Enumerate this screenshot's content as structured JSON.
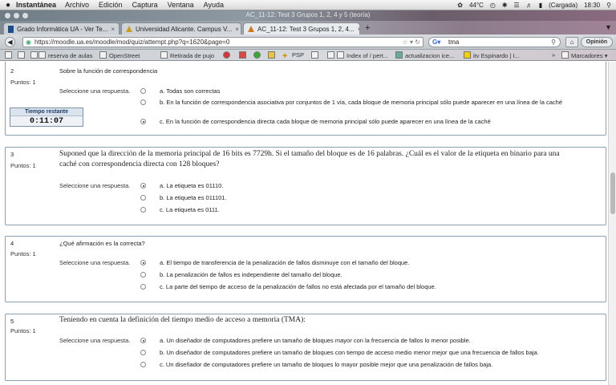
{
  "menubar": {
    "apple": "",
    "app": "Instantánea",
    "items": [
      "Archivo",
      "Edición",
      "Captura",
      "Ventana",
      "Ayuda"
    ],
    "temperature": "44°C",
    "battery": "(Cargada)",
    "clock": "18:30"
  },
  "window": {
    "title": "AC_11-12: Test 3 Grupos 1, 2, 4 y 5 (teoría)"
  },
  "tabs": [
    {
      "label": "Grado Informática UA - Ver Te..."
    },
    {
      "label": "Universidad Alicante. Campus V..."
    },
    {
      "label": "AC_11-12: Test 3 Grupos 1, 2, 4..."
    }
  ],
  "newtab_label": "+",
  "navbar": {
    "url": "https://moodle.ua.es/moodle/mod/quiz/attempt.php?q=1620&page=0",
    "search_value": "tma",
    "options_label": "Opinión"
  },
  "bookmarks": {
    "items": [
      "reserva de aulas",
      "OpenStreet",
      "Retirada de pujo",
      "PSP",
      "Index of / pert...",
      "actualizacion ice...",
      "itv Espinardo | I..."
    ],
    "overflow": "»",
    "folder": "Marcadores"
  },
  "timer": {
    "label": "Tiempo restante",
    "value": "0:11:07"
  },
  "common": {
    "points": "Puntos: 1",
    "select_prompt": "Seleccione una respuesta."
  },
  "questions": [
    {
      "number": "2",
      "text": "Sobre la función de correspondencia",
      "options": [
        {
          "text": "a. Todas son correctas",
          "selected": false
        },
        {
          "text": "b. En la función de correspondencia asociativa por conjuntos de 1 vía, cada bloque de memoria principal sólo puede aparecer en una línea de la caché",
          "selected": false
        },
        {
          "text": "c. En la función de correspondencia directa cada bloque de memoria principal sólo puede aparecer en una línea de la caché",
          "selected": true
        }
      ]
    },
    {
      "number": "3",
      "text": "Suponed que la dirección de la memoria principal de 16 bits es 7729h. Si el tamaño del bloque es de 16 palabras. ¿Cuál es el valor de la etiqueta en binario para una caché con correspondencia directa con 128 bloques?",
      "options": [
        {
          "text": "a. La etiqueta es 01110.",
          "selected": true
        },
        {
          "text": "b. La etiqueta es 011101.",
          "selected": false
        },
        {
          "text": "c. La etiqueta es 0111.",
          "selected": false
        }
      ]
    },
    {
      "number": "4",
      "text": "¿Qué afirmación es la correcta?",
      "options": [
        {
          "text": "a. El tiempo de transferencia de la penalización de fallos disminuye con el tamaño del bloque.",
          "selected": true
        },
        {
          "text": "b. La penalización de fallos es independiente del tamaño del bloque.",
          "selected": false
        },
        {
          "text": "c. La parte del tiempo de acceso de la penalización de fallos no está afectada por el tamaño del bloque.",
          "selected": false
        }
      ]
    },
    {
      "number": "5",
      "text": "Teniendo en cuenta la definición del tiempo medio de acceso a memoria (TMA):",
      "options": [
        {
          "text": "a. Un diseñador de computadores prefiere un tamaño de bloques mayor con la frecuencia de fallos lo menor posible.",
          "selected": true
        },
        {
          "text": "b. Un diseñador de computadores prefiere un tamaño de bloques con tiempo de acceso medio menor mejor que una frecuencia de fallos baja.",
          "selected": false
        },
        {
          "text": "c. Un diseñador de computadores prefiere un tamaño de bloques lo mayor posible mejor que una penalización de fallos baja.",
          "selected": false
        }
      ]
    }
  ]
}
